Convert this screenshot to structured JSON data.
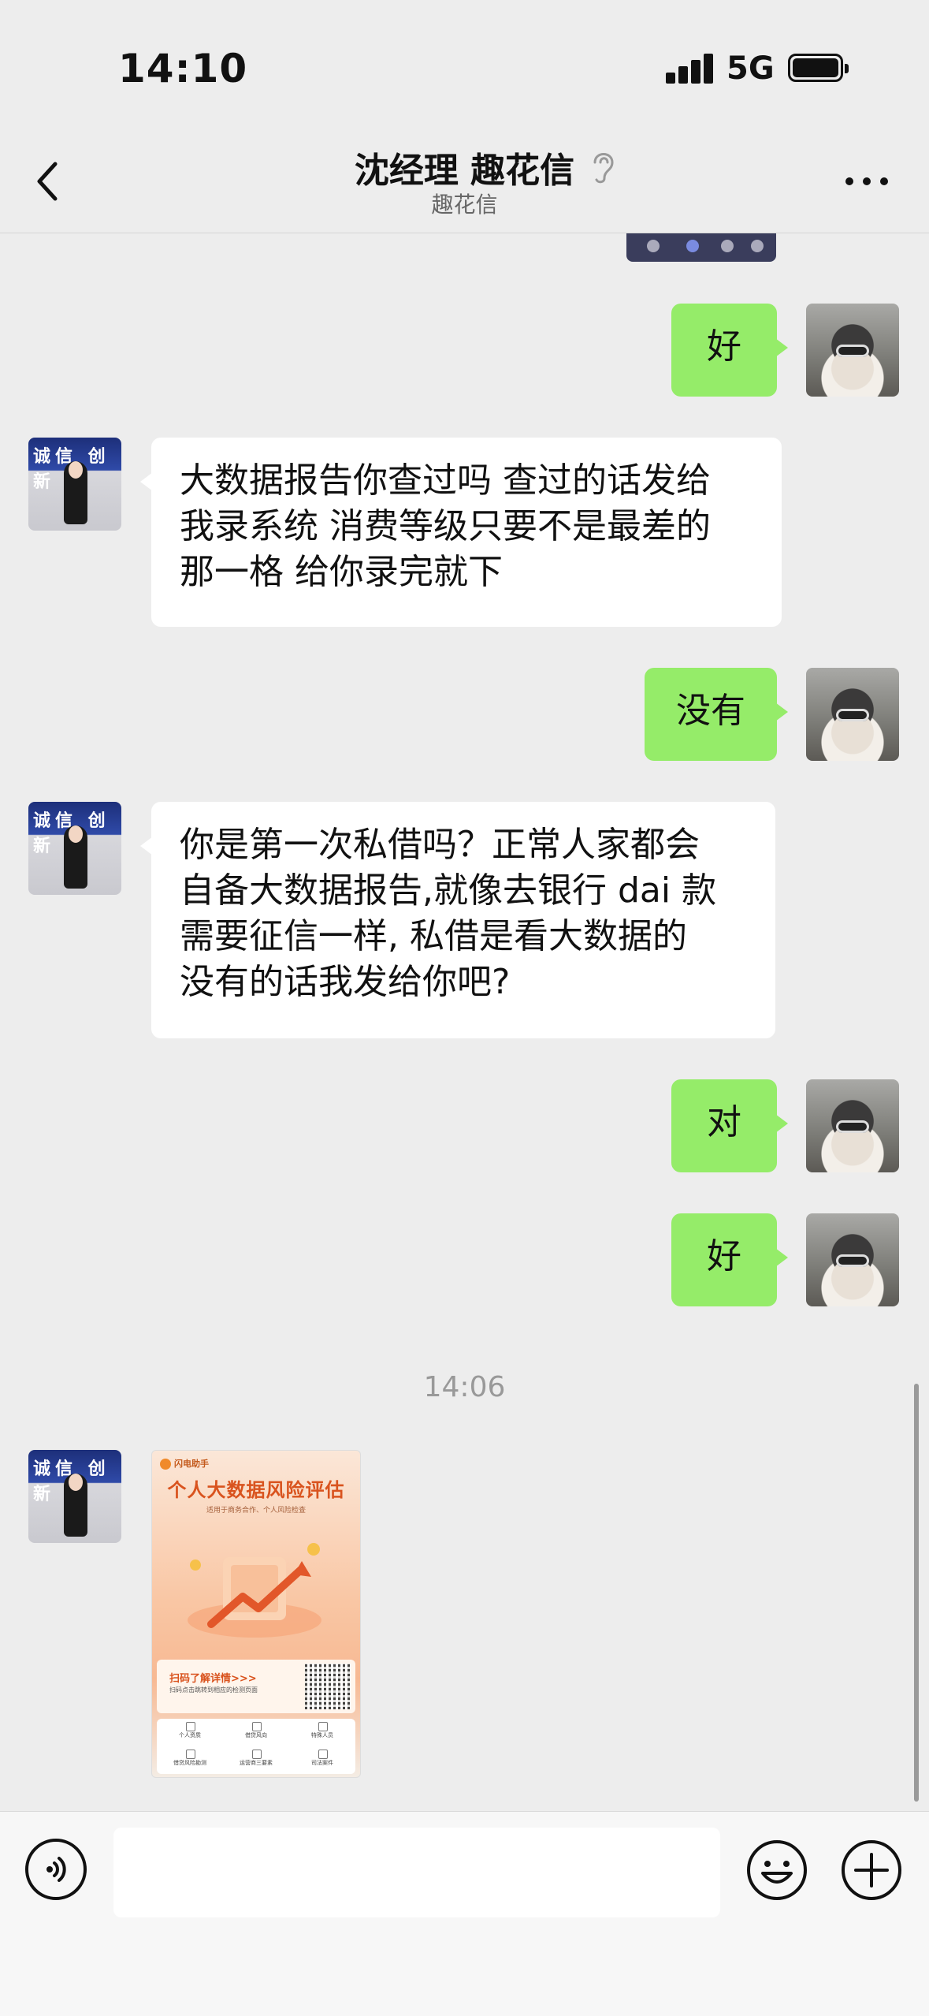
{
  "status_bar": {
    "time": "14:10",
    "network": "5G"
  },
  "header": {
    "title": "沈经理 趣花信",
    "subtitle": "趣花信"
  },
  "messages": [
    {
      "sender": "me",
      "text": "好"
    },
    {
      "sender": "them",
      "lines": [
        "大数据报告你查过吗 查过的话发给",
        "我录系统 消费等级只要不是最差的",
        "那一格 给你录完就下"
      ]
    },
    {
      "sender": "me",
      "text": "没有"
    },
    {
      "sender": "them",
      "lines": [
        "你是第一次私借吗？正常人家都会",
        "自备大数据报告,就像去银行 dai 款",
        "需要征信一样, 私借是看大数据的",
        "没有的话我发给你吧?"
      ]
    },
    {
      "sender": "me",
      "text": "对"
    },
    {
      "sender": "me",
      "text": "好"
    }
  ],
  "timestamp": "14:06",
  "poster": {
    "brand": "闪电助手",
    "headline": "个人大数据风险评估",
    "tagline": "适用于商务合作、个人风险检查",
    "cta": "扫码了解详情>>>",
    "cta_note": "扫码点击跳转到相应的检测页面",
    "grid": [
      "个人资质",
      "借贷风向",
      "特殊人员",
      "借贷风险勘测",
      "运营商三要素",
      "司法案件"
    ]
  },
  "agent_avatar_sign": "诚信 创新",
  "input": {
    "placeholder": ""
  },
  "colors": {
    "my_bubble": "#95ec69",
    "their_bubble": "#ffffff",
    "background": "#ededed"
  },
  "icons": [
    "back-chevron-icon",
    "ear-icon",
    "more-icon",
    "voice-icon",
    "emoji-icon",
    "add-icon"
  ]
}
